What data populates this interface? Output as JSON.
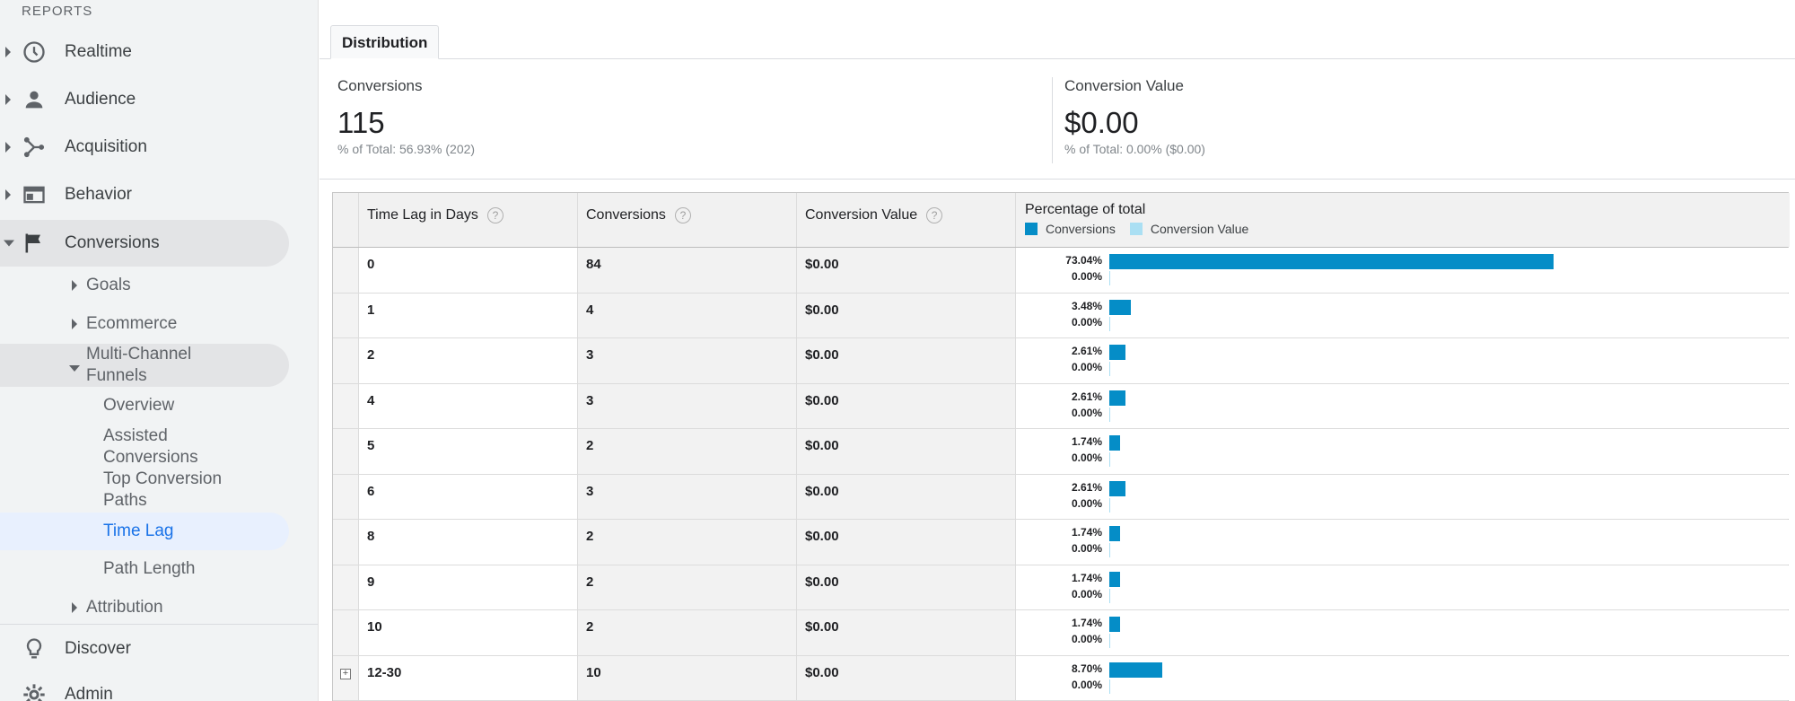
{
  "sidebar": {
    "section_header": "REPORTS",
    "top_items": [
      {
        "label": "Realtime",
        "icon": "clock-icon"
      },
      {
        "label": "Audience",
        "icon": "person-icon"
      },
      {
        "label": "Acquisition",
        "icon": "acquisition-icon"
      },
      {
        "label": "Behavior",
        "icon": "behavior-icon"
      },
      {
        "label": "Conversions",
        "icon": "flag-icon"
      }
    ],
    "conversions_sub": {
      "goals": "Goals",
      "ecommerce": "Ecommerce",
      "multi_channel": "Multi-Channel Funnels",
      "attribution": "Attribution"
    },
    "mcf_items": {
      "overview": "Overview",
      "assisted": "Assisted Conversions",
      "top_paths": "Top Conversion Paths",
      "time_lag": "Time Lag",
      "path_length": "Path Length"
    },
    "bottom_items": [
      {
        "label": "Discover",
        "icon": "lightbulb-icon"
      },
      {
        "label": "Admin",
        "icon": "gear-icon"
      }
    ]
  },
  "tabs": {
    "distribution": "Distribution"
  },
  "summary": {
    "conversions": {
      "label": "Conversions",
      "value": "115",
      "sub": "% of Total: 56.93% (202)"
    },
    "conversion_value": {
      "label": "Conversion Value",
      "value": "$0.00",
      "sub": "% of Total: 0.00% ($0.00)"
    }
  },
  "table": {
    "headers": {
      "time_lag": "Time Lag in Days",
      "conversions": "Conversions",
      "conversion_value": "Conversion Value",
      "percentage": "Percentage of total",
      "legend_conversions": "Conversions",
      "legend_value": "Conversion Value",
      "help": "?"
    },
    "rows": [
      {
        "lag": "0",
        "conversions": "84",
        "value": "$0.00",
        "pct_conv": "73.04%",
        "pct_value": "0.00%"
      },
      {
        "lag": "1",
        "conversions": "4",
        "value": "$0.00",
        "pct_conv": "3.48%",
        "pct_value": "0.00%"
      },
      {
        "lag": "2",
        "conversions": "3",
        "value": "$0.00",
        "pct_conv": "2.61%",
        "pct_value": "0.00%"
      },
      {
        "lag": "4",
        "conversions": "3",
        "value": "$0.00",
        "pct_conv": "2.61%",
        "pct_value": "0.00%"
      },
      {
        "lag": "5",
        "conversions": "2",
        "value": "$0.00",
        "pct_conv": "1.74%",
        "pct_value": "0.00%"
      },
      {
        "lag": "6",
        "conversions": "3",
        "value": "$0.00",
        "pct_conv": "2.61%",
        "pct_value": "0.00%"
      },
      {
        "lag": "8",
        "conversions": "2",
        "value": "$0.00",
        "pct_conv": "1.74%",
        "pct_value": "0.00%"
      },
      {
        "lag": "9",
        "conversions": "2",
        "value": "$0.00",
        "pct_conv": "1.74%",
        "pct_value": "0.00%"
      },
      {
        "lag": "10",
        "conversions": "2",
        "value": "$0.00",
        "pct_conv": "1.74%",
        "pct_value": "0.00%"
      },
      {
        "lag": "12-30",
        "conversions": "10",
        "value": "$0.00",
        "pct_conv": "8.70%",
        "pct_value": "0.00%",
        "expandable": true
      }
    ]
  },
  "colors": {
    "conversions_bar": "#058dc7",
    "value_bar": "#aadff3",
    "active_nav": "#1a73e8"
  }
}
